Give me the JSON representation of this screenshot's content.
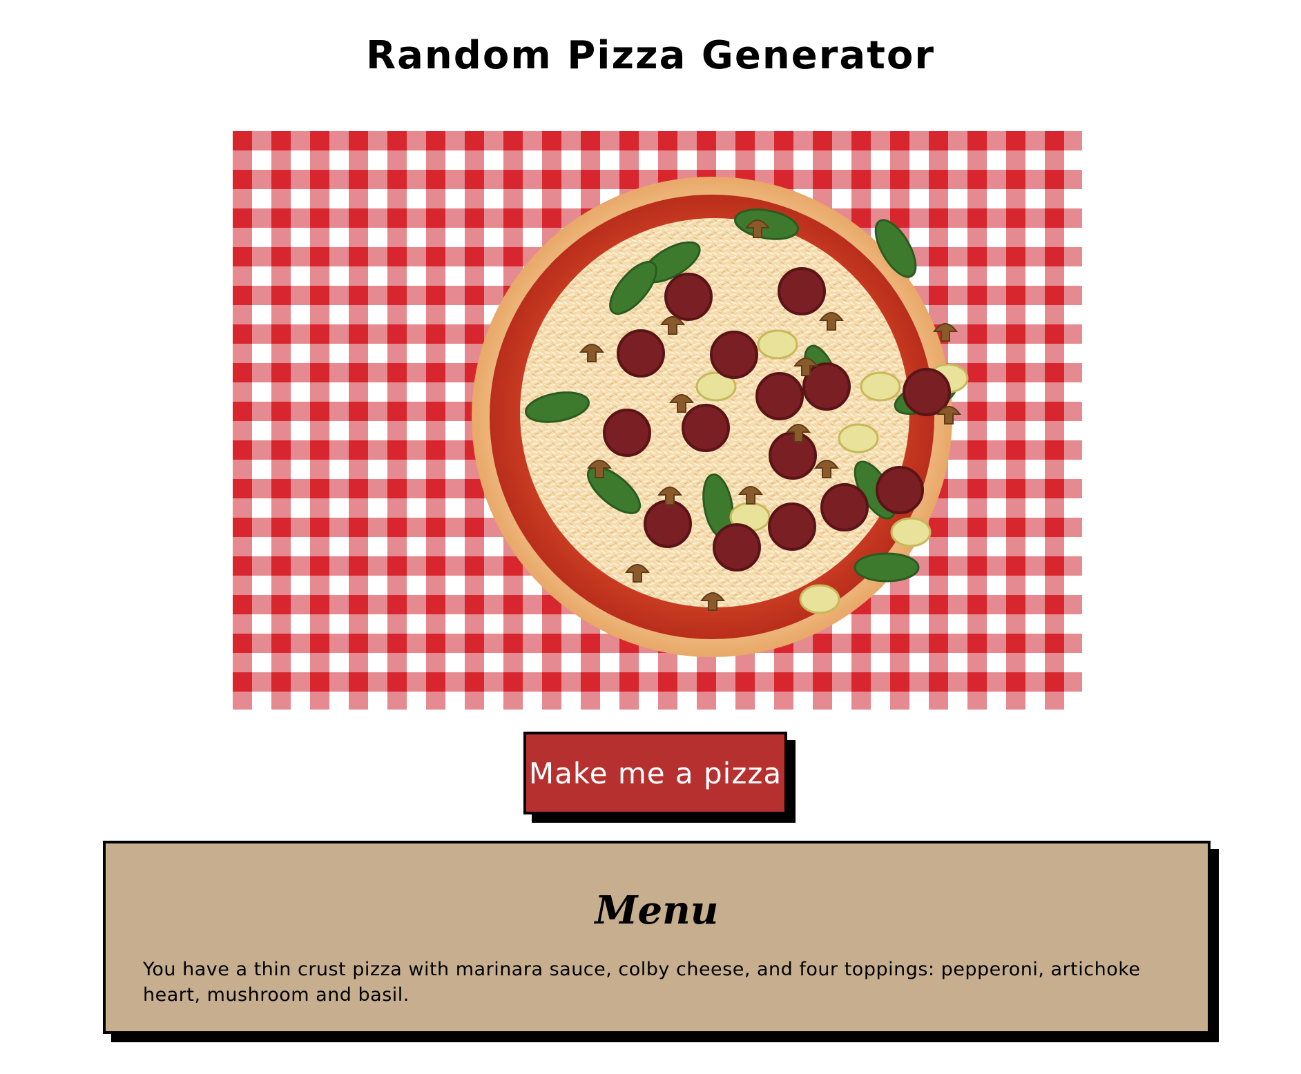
{
  "page": {
    "title": "Random Pizza Generator"
  },
  "pizza_image": {
    "tablecloth_color": "#d8262f",
    "crust_color": "#efb47c",
    "sauce_color": "#c93a23",
    "cheese_color": "#f7e2b8",
    "toppings": [
      "pepperoni-icon",
      "artichoke-icon",
      "mushroom-icon",
      "basil-icon"
    ]
  },
  "actions": {
    "make_button_label": "Make me a pizza",
    "button_color": "#b73030"
  },
  "menu": {
    "heading": "Menu",
    "description": "You have a thin crust pizza with marinara sauce, colby cheese, and four toppings: pepperoni, artichoke heart, mushroom and basil.",
    "background_color": "#c6ae8f"
  }
}
